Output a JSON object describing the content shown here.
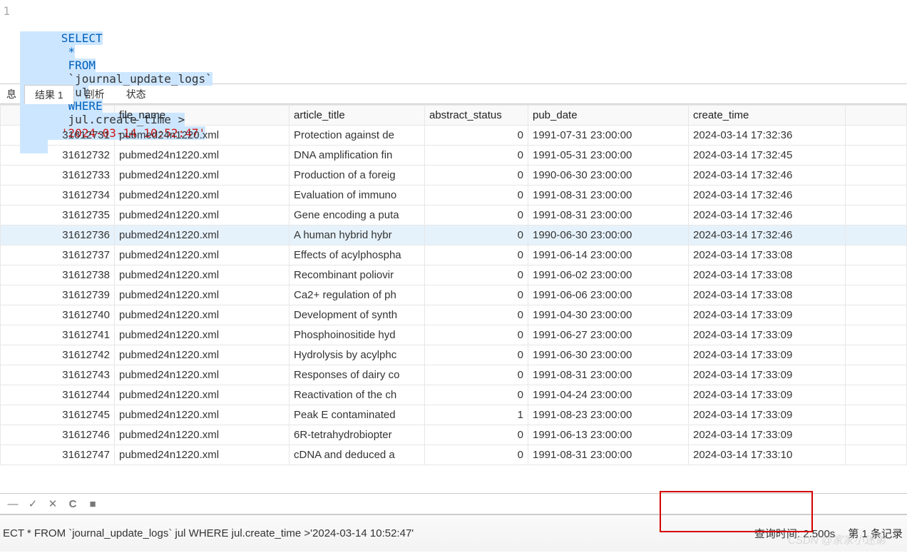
{
  "sql": {
    "line_no": "1",
    "tokens": {
      "select": "SELECT",
      "star": "*",
      "from": "FROM",
      "table": "`journal_update_logs`",
      "alias": "jul",
      "where": "WHERE",
      "cond_left": "jul.create_time >",
      "str": "'2024-03-14 10:52:47'"
    }
  },
  "tabs": {
    "partial": "息",
    "result": "结果 1",
    "profile": "剖析",
    "status": "状态"
  },
  "columns": {
    "id_hdr": "",
    "file_name": "file_name",
    "article_title": "article_title",
    "abstract_status": "abstract_status",
    "pub_date": "pub_date",
    "create_time": "create_time"
  },
  "rows": [
    {
      "id": "31612731",
      "file": "pubmed24n1220.xml",
      "title": "Protection against de",
      "abs": "0",
      "pub": "1991-07-31 23:00:00",
      "ct": "2024-03-14 17:32:36"
    },
    {
      "id": "31612732",
      "file": "pubmed24n1220.xml",
      "title": "DNA amplification fin",
      "abs": "0",
      "pub": "1991-05-31 23:00:00",
      "ct": "2024-03-14 17:32:45"
    },
    {
      "id": "31612733",
      "file": "pubmed24n1220.xml",
      "title": "Production of a foreig",
      "abs": "0",
      "pub": "1990-06-30 23:00:00",
      "ct": "2024-03-14 17:32:46"
    },
    {
      "id": "31612734",
      "file": "pubmed24n1220.xml",
      "title": "Evaluation of immuno",
      "abs": "0",
      "pub": "1991-08-31 23:00:00",
      "ct": "2024-03-14 17:32:46"
    },
    {
      "id": "31612735",
      "file": "pubmed24n1220.xml",
      "title": "Gene encoding a puta",
      "abs": "0",
      "pub": "1991-08-31 23:00:00",
      "ct": "2024-03-14 17:32:46"
    },
    {
      "id": "31612736",
      "file": "pubmed24n1220.xml",
      "title": "A human hybrid hybr",
      "abs": "0",
      "pub": "1990-06-30 23:00:00",
      "ct": "2024-03-14 17:32:46",
      "selected": true
    },
    {
      "id": "31612737",
      "file": "pubmed24n1220.xml",
      "title": "Effects of acylphospha",
      "abs": "0",
      "pub": "1991-06-14 23:00:00",
      "ct": "2024-03-14 17:33:08"
    },
    {
      "id": "31612738",
      "file": "pubmed24n1220.xml",
      "title": "Recombinant poliovir",
      "abs": "0",
      "pub": "1991-06-02 23:00:00",
      "ct": "2024-03-14 17:33:08"
    },
    {
      "id": "31612739",
      "file": "pubmed24n1220.xml",
      "title": "Ca2+ regulation of ph",
      "abs": "0",
      "pub": "1991-06-06 23:00:00",
      "ct": "2024-03-14 17:33:08"
    },
    {
      "id": "31612740",
      "file": "pubmed24n1220.xml",
      "title": "Development of synth",
      "abs": "0",
      "pub": "1991-04-30 23:00:00",
      "ct": "2024-03-14 17:33:09"
    },
    {
      "id": "31612741",
      "file": "pubmed24n1220.xml",
      "title": "Phosphoinositide hyd",
      "abs": "0",
      "pub": "1991-06-27 23:00:00",
      "ct": "2024-03-14 17:33:09"
    },
    {
      "id": "31612742",
      "file": "pubmed24n1220.xml",
      "title": "Hydrolysis by acylphc",
      "abs": "0",
      "pub": "1991-06-30 23:00:00",
      "ct": "2024-03-14 17:33:09"
    },
    {
      "id": "31612743",
      "file": "pubmed24n1220.xml",
      "title": "Responses of dairy co",
      "abs": "0",
      "pub": "1991-08-31 23:00:00",
      "ct": "2024-03-14 17:33:09"
    },
    {
      "id": "31612744",
      "file": "pubmed24n1220.xml",
      "title": "Reactivation of the ch",
      "abs": "0",
      "pub": "1991-04-24 23:00:00",
      "ct": "2024-03-14 17:33:09"
    },
    {
      "id": "31612745",
      "file": "pubmed24n1220.xml",
      "title": "Peak E contaminated",
      "abs": "1",
      "pub": "1991-08-23 23:00:00",
      "ct": "2024-03-14 17:33:09"
    },
    {
      "id": "31612746",
      "file": "pubmed24n1220.xml",
      "title": "6R-tetrahydrobiopter",
      "abs": "0",
      "pub": "1991-06-13 23:00:00",
      "ct": "2024-03-14 17:33:09"
    },
    {
      "id": "31612747",
      "file": "pubmed24n1220.xml",
      "title": "cDNA and deduced a",
      "abs": "0",
      "pub": "1991-08-31 23:00:00",
      "ct": "2024-03-14 17:33:10"
    }
  ],
  "status": {
    "left": "ECT * FROM `journal_update_logs` jul WHERE jul.create_time >'2024-03-14 10:52:47'",
    "query_time_label": "查询时间: ",
    "query_time_value": "2.500s",
    "record_label": "第 1 条记录"
  },
  "icons": {
    "minus": "—",
    "check": "✓",
    "cross": "✕",
    "refresh": "C",
    "stop": "■"
  },
  "watermark": "CSDN @家家小迷弟"
}
